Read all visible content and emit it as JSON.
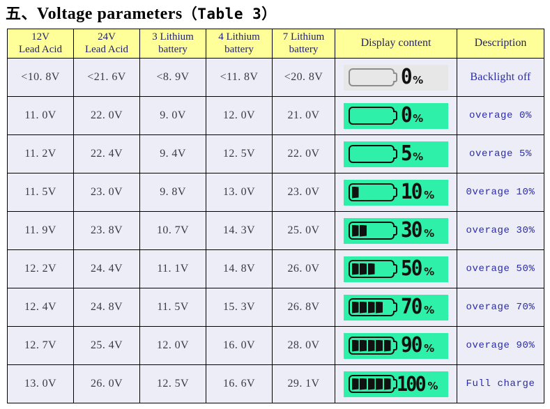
{
  "title": {
    "section": "五、",
    "text": "Voltage parameters",
    "paren": "（Table 3）"
  },
  "colors": {
    "header_bg": "#FFFF99",
    "header_text": "#222268",
    "cell_bg": "#EDEDF7",
    "desc_text": "#2B2BA8",
    "lcd_green": "#2FF0A8",
    "lcd_off": "#E7E7E7",
    "segment_black": "#111111"
  },
  "table": {
    "headers": [
      "12V\nLead Acid",
      "24V\nLead Acid",
      "3 Lithium\nbattery",
      "4 Lithium\nbattery",
      "7 Lithium\nbattery",
      "Display content",
      "Description"
    ],
    "headers_flat": {
      "h1_line1": "12V",
      "h1_line2": "Lead Acid",
      "h2_line1": "24V",
      "h2_line2": "Lead Acid",
      "h3_line1": "3 Lithium",
      "h3_line2": "battery",
      "h4_line1": "4 Lithium",
      "h4_line2": "battery",
      "h5_line1": "7 Lithium",
      "h5_line2": "battery",
      "h6": "Display content",
      "h7": "Description"
    },
    "rows": [
      {
        "v12": "<10. 8V",
        "v24": "<21. 6V",
        "li3": "<8. 9V",
        "li4": "<11. 8V",
        "li7": "<20. 8V",
        "percent": "0",
        "bars": 0,
        "backlight": false,
        "desc": "Backlight off"
      },
      {
        "v12": "11. 0V",
        "v24": "22. 0V",
        "li3": "9. 0V",
        "li4": "12. 0V",
        "li7": "21. 0V",
        "percent": "0",
        "bars": 0,
        "backlight": true,
        "desc": "overage 0%"
      },
      {
        "v12": "11. 2V",
        "v24": "22. 4V",
        "li3": "9. 4V",
        "li4": "12. 5V",
        "li7": "22. 0V",
        "percent": "5",
        "bars": 0,
        "backlight": true,
        "desc": "overage 5%"
      },
      {
        "v12": "11. 5V",
        "v24": "23. 0V",
        "li3": "9. 8V",
        "li4": "13. 0V",
        "li7": "23. 0V",
        "percent": "10",
        "bars": 1,
        "backlight": true,
        "desc": "0verage 10%"
      },
      {
        "v12": "11. 9V",
        "v24": "23. 8V",
        "li3": "10. 7V",
        "li4": "14. 3V",
        "li7": "25. 0V",
        "percent": "30",
        "bars": 2,
        "backlight": true,
        "desc": "overage 30%"
      },
      {
        "v12": "12. 2V",
        "v24": "24. 4V",
        "li3": "11. 1V",
        "li4": "14. 8V",
        "li7": "26. 0V",
        "percent": "50",
        "bars": 3,
        "backlight": true,
        "desc": "overage 50%"
      },
      {
        "v12": "12. 4V",
        "v24": "24. 8V",
        "li3": "11. 5V",
        "li4": "15. 3V",
        "li7": "26. 8V",
        "percent": "70",
        "bars": 4,
        "backlight": true,
        "desc": "overage 70%"
      },
      {
        "v12": "12. 7V",
        "v24": "25. 4V",
        "li3": "12. 0V",
        "li4": "16. 0V",
        "li7": "28. 0V",
        "percent": "90",
        "bars": 5,
        "backlight": true,
        "desc": "overage 90%"
      },
      {
        "v12": "13. 0V",
        "v24": "26. 0V",
        "li3": "12. 5V",
        "li4": "16. 6V",
        "li7": "29. 1V",
        "percent": "100",
        "bars": 5,
        "backlight": true,
        "desc": "Full charge"
      }
    ],
    "percent_symbol": "%"
  }
}
